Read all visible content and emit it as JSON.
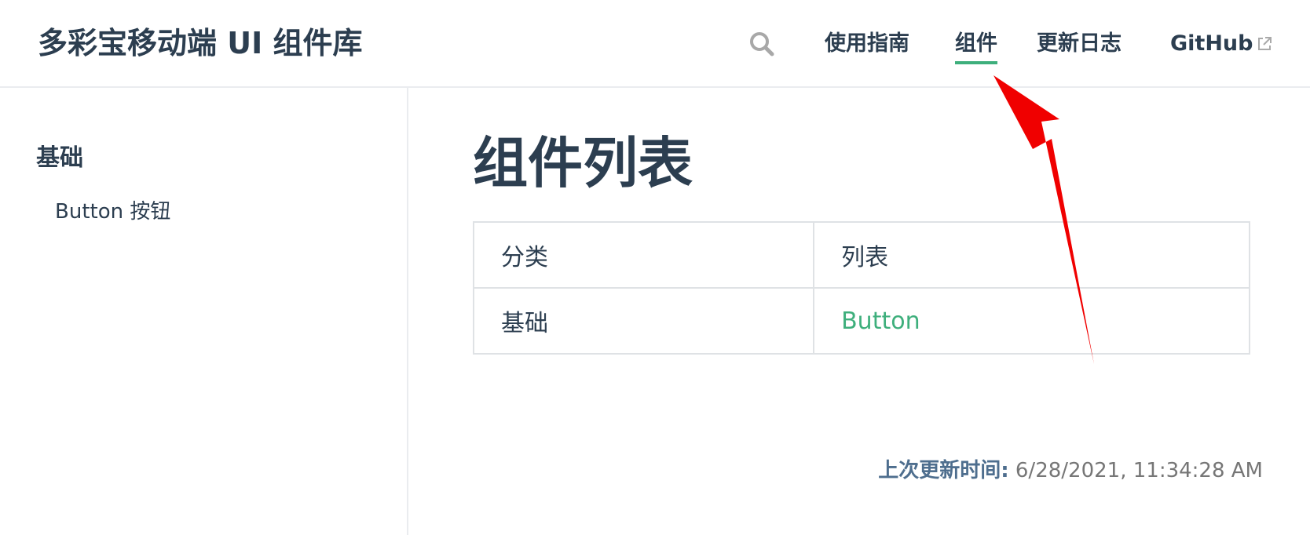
{
  "navbar": {
    "site_title": "多彩宝移动端 UI 组件库",
    "search_icon": "search-icon",
    "links": {
      "guide": "使用指南",
      "components": "组件",
      "changelog": "更新日志",
      "github": "GitHub"
    },
    "external_icon": "external-link-icon",
    "active_link": "组件",
    "accent_color": "#3eaf7c"
  },
  "sidebar": {
    "group_title": "基础",
    "items": [
      {
        "label": "Button 按钮"
      }
    ]
  },
  "main": {
    "title": "组件列表",
    "table": {
      "headers": [
        "分类",
        "列表"
      ],
      "rows": [
        {
          "category": "基础",
          "component": "Button"
        }
      ]
    },
    "last_updated": {
      "prefix": "上次更新时间:",
      "time": "6/28/2021, 11:34:28 AM"
    }
  },
  "annotation": {
    "type": "red-arrow",
    "color": "#f00000",
    "points_to": "组件"
  }
}
